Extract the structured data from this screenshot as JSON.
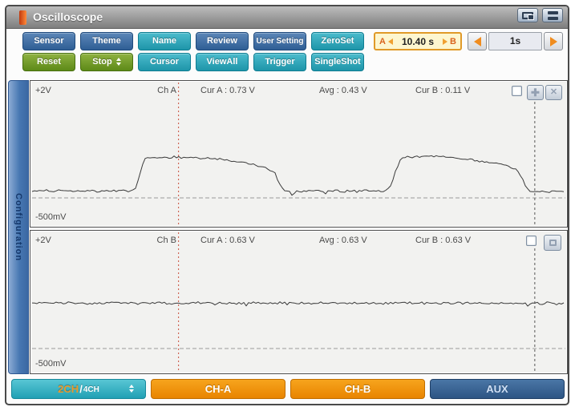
{
  "window": {
    "title": "Oscilloscope"
  },
  "titlebar": {
    "buttons": [
      "display-switch",
      "minimize-bars"
    ]
  },
  "toolbar": {
    "row1": [
      "Sensor",
      "Theme",
      "Name",
      "Review",
      "User Setting",
      "ZeroSet"
    ],
    "row2": [
      "Reset",
      "Stop",
      "Cursor",
      "ViewAll",
      "Trigger",
      "SingleShot"
    ],
    "cursor_time": {
      "marker_a": "A",
      "marker_b": "B",
      "value": "10.40 s"
    },
    "timebase": {
      "value": "1s"
    }
  },
  "sidebar": {
    "label": "Configuration"
  },
  "panels": [
    {
      "scale_top": "+2V",
      "scale_bottom": "-500mV",
      "channel": "Ch A",
      "readings": [
        "Cur A :  0.73 V",
        "Avg :  0.43 V",
        "Cur B :  0.11 V"
      ]
    },
    {
      "scale_top": "+2V",
      "scale_bottom": "-500mV",
      "channel": "Ch B",
      "readings": [
        "Cur A :  0.63 V",
        "Avg :  0.63 V",
        "Cur B :  0.63 V"
      ]
    }
  ],
  "bottombar": {
    "channel_mode": {
      "selected": "2CH",
      "separator": "/",
      "alternate": "4CH"
    },
    "ch_a": "CH-A",
    "ch_b": "CH-B",
    "aux": "AUX"
  },
  "colors": {
    "button_blue": "#37679b",
    "button_teal": "#27a2b4",
    "button_green": "#68911f",
    "channel_orange": "#ef9109",
    "aux_navy": "#33608e",
    "cursor_red": "#c94f3d",
    "cursor_gray": "#555555",
    "sidebar_blue": "#4a78b4",
    "trace": "#3a3a3a"
  },
  "chart_data": [
    {
      "type": "line",
      "title": "Ch A",
      "ylabel": "V",
      "ylim": [
        -0.5,
        2.0
      ],
      "y_top_label": "+2V",
      "y_bottom_label": "-500mV",
      "grid": false,
      "series": [
        {
          "name": "Ch A",
          "points": [
            [
              0.0,
              0.13
            ],
            [
              0.19,
              0.13
            ],
            [
              0.198,
              0.2
            ],
            [
              0.205,
              0.5
            ],
            [
              0.212,
              0.72
            ],
            [
              0.228,
              0.75
            ],
            [
              0.29,
              0.74
            ],
            [
              0.35,
              0.71
            ],
            [
              0.39,
              0.66
            ],
            [
              0.437,
              0.56
            ],
            [
              0.455,
              0.47
            ],
            [
              0.465,
              0.25
            ],
            [
              0.472,
              0.13
            ],
            [
              0.486,
              0.12
            ],
            [
              0.489,
              -0.05
            ],
            [
              0.493,
              0.12
            ],
            [
              0.66,
              0.13
            ],
            [
              0.672,
              0.22
            ],
            [
              0.681,
              0.5
            ],
            [
              0.69,
              0.72
            ],
            [
              0.712,
              0.76
            ],
            [
              0.757,
              0.77
            ],
            [
              0.84,
              0.68
            ],
            [
              0.884,
              0.6
            ],
            [
              0.906,
              0.53
            ],
            [
              0.917,
              0.37
            ],
            [
              0.924,
              0.18
            ],
            [
              0.931,
              0.12
            ],
            [
              1.0,
              0.12
            ]
          ]
        }
      ],
      "cursors": {
        "cur_a_frac": 0.276,
        "cur_b_frac": 0.94
      },
      "measurements": {
        "cur_a_v": 0.73,
        "avg_v": 0.43,
        "cur_b_v": 0.11
      }
    },
    {
      "type": "line",
      "title": "Ch B",
      "ylabel": "V",
      "ylim": [
        -0.5,
        2.0
      ],
      "y_top_label": "+2V",
      "y_bottom_label": "-500mV",
      "grid": false,
      "series": [
        {
          "name": "Ch B",
          "points": [
            [
              0.0,
              0.63
            ],
            [
              1.0,
              0.63
            ]
          ]
        }
      ],
      "cursors": {
        "cur_a_frac": 0.276,
        "cur_b_frac": 0.94
      },
      "measurements": {
        "cur_a_v": 0.63,
        "avg_v": 0.63,
        "cur_b_v": 0.63
      }
    }
  ]
}
